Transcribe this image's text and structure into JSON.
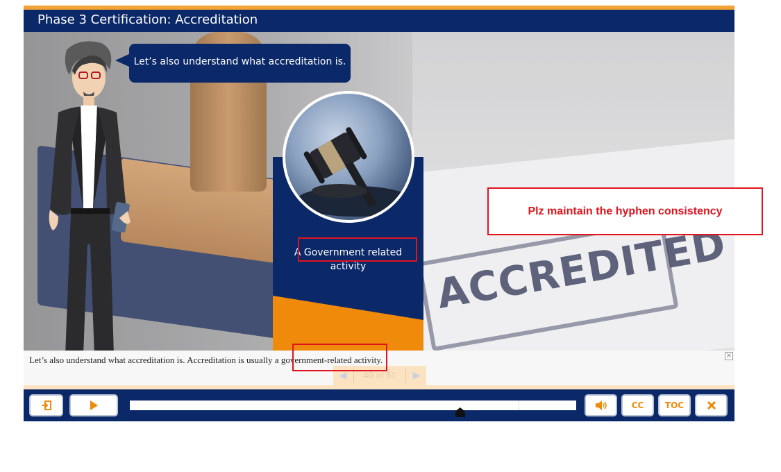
{
  "header": {
    "title": "Phase 3 Certification: Accreditation"
  },
  "scene": {
    "stamp_text": "ACCREDITED"
  },
  "speech_bubble": {
    "text": "Let’s also understand what accreditation is."
  },
  "card": {
    "text_line1": "A Government related",
    "text_line2": "activity"
  },
  "caption": {
    "text": "Let’s also understand what accreditation is. Accreditation is usually a government-related activity.",
    "close_label": "×"
  },
  "pager": {
    "prev_label": "◀",
    "next_label": "▶",
    "count": "40 of 51"
  },
  "controls": {
    "exit_icon": "exit-icon",
    "play_icon": "play-icon",
    "volume_icon": "volume-icon",
    "cc_label": "CC",
    "toc_label": "TOC",
    "close_icon": "close-icon",
    "progress_fraction": 0.74
  },
  "annotation": {
    "note": "Plz maintain the hyphen consistency"
  },
  "colors": {
    "navy": "#0b2868",
    "orange": "#ef8a0a",
    "accent_red": "#e0141e",
    "stripe": "#f4a436"
  }
}
